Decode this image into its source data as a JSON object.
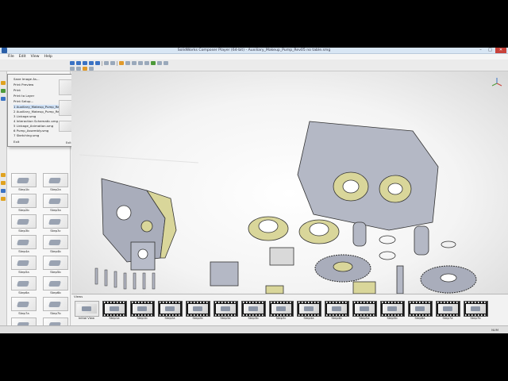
{
  "window": {
    "title": "SolidWorks Composer Player (64-bit) - Auxiliary_Makeup_Pump_Rev05 no table.smg",
    "buttons": {
      "minimize": "–",
      "maximize": "□",
      "close": "✕"
    }
  },
  "menu": {
    "items": [
      "File",
      "Edit",
      "View",
      "Help"
    ]
  },
  "file_menu": {
    "items": [
      "Save Image As...",
      "Print Preview",
      "Print",
      "Print to Layer",
      "Print Setup...",
      "1 Auxiliary_Makeup_Pump_Rev05 no table.smg",
      "2 Auxiliary_Makeup_Pump_Rev05 no table.smg",
      "3 Linkage.smg",
      "4 Interaction Schematic.smg",
      "5 Linkage_Animation.smg",
      "6 Pump_Assembly.smg",
      "7 Sketching.smg",
      "Exit"
    ],
    "exit_label": "Exit Ctrl+Q"
  },
  "steps_panel": {
    "steps": [
      "Step1b",
      "Step2a",
      "Step2b",
      "Step3a",
      "Step3b",
      "Step3c",
      "Step4a",
      "Step4b",
      "Step5a",
      "Step5b",
      "Step6a",
      "Step6b",
      "Step7a",
      "Step7b",
      "Step8a",
      "Step8b"
    ]
  },
  "views_panel": {
    "title": "Views",
    "views": [
      "Initial View",
      "Step1a",
      "Step1b",
      "Step2a",
      "Step2b",
      "Step3a",
      "Step3b",
      "Step3c",
      "Step4a",
      "Step4b",
      "Step5a",
      "Step5b",
      "Step6a",
      "Step7a",
      "Step7b"
    ]
  },
  "status": {
    "right_text": "NUM"
  },
  "colors": {
    "accent": "#3a72c4",
    "part_gray": "#a9adbb",
    "part_yellow": "#d9d69a",
    "close": "#c8423a"
  }
}
